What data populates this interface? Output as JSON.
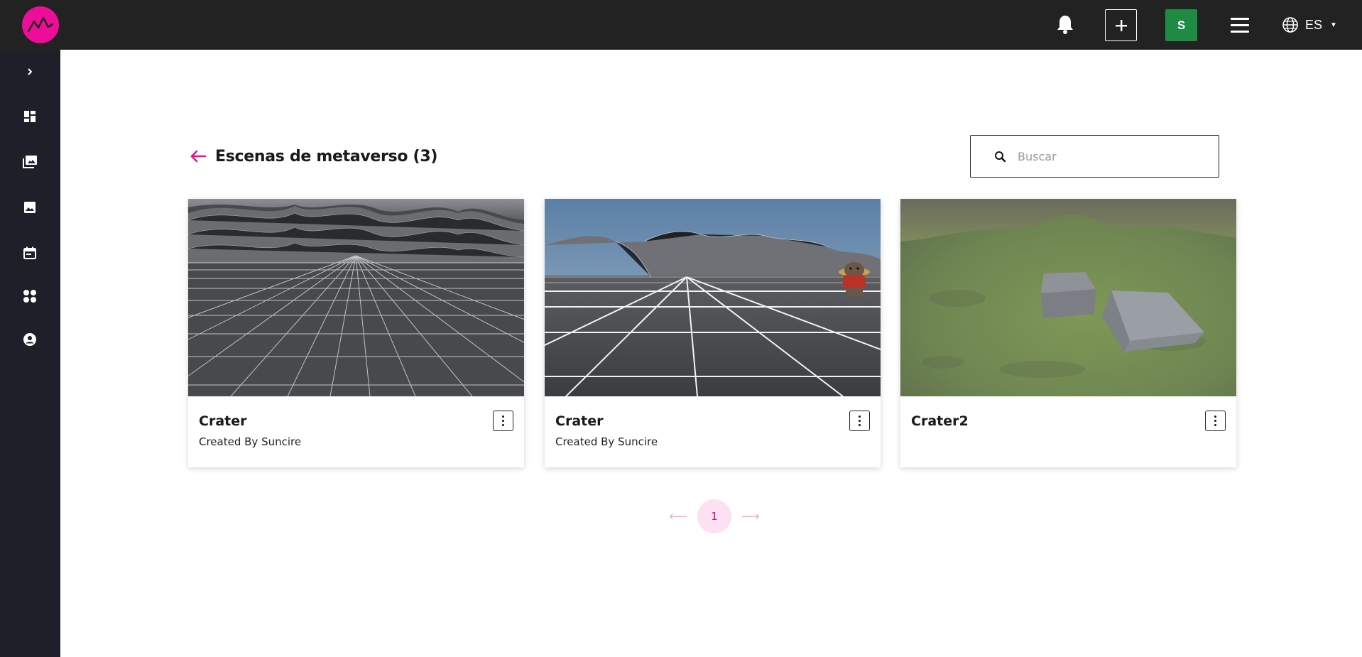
{
  "header": {
    "avatar_initial": "S",
    "language": "ES",
    "brand_color": "#ee0d99",
    "avatar_color": "#1f8a43"
  },
  "sidebar": {
    "items": [
      {
        "icon": "chevron-right-icon"
      },
      {
        "icon": "dashboard-icon"
      },
      {
        "icon": "photo-library-icon"
      },
      {
        "icon": "image-icon"
      },
      {
        "icon": "calendar-icon"
      },
      {
        "icon": "apps-icon"
      },
      {
        "icon": "account-circle-icon"
      }
    ]
  },
  "page": {
    "title": "Escenas de metaverso (3)"
  },
  "search": {
    "placeholder": "Buscar",
    "value": ""
  },
  "cards": [
    {
      "name": "Crater",
      "creator": "Created By Suncire",
      "thumbnail": "wireframe-terrain-grey-sky"
    },
    {
      "name": "Crater",
      "creator": "Created By Suncire",
      "thumbnail": "wireframe-terrain-blue-sky-with-avatar"
    },
    {
      "name": "Crater2",
      "creator": "",
      "thumbnail": "grass-terrain-with-grey-blocks"
    }
  ],
  "pagination": {
    "current_page": "1",
    "accent_color": "#d3108a"
  }
}
